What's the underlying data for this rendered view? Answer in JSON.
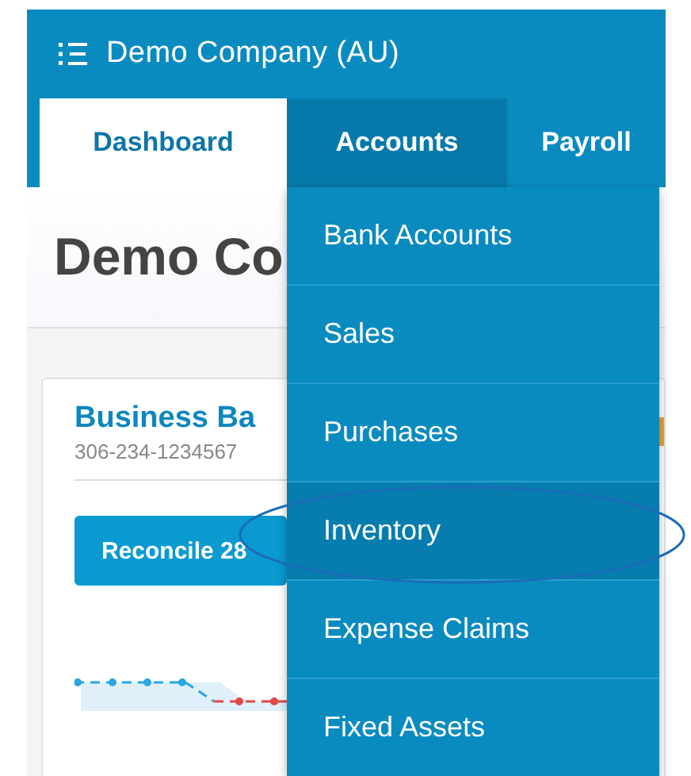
{
  "header": {
    "company": "Demo Company (AU)"
  },
  "tabs": [
    {
      "label": "Dashboard",
      "selected": true,
      "expanded": false
    },
    {
      "label": "Accounts",
      "selected": false,
      "expanded": true
    },
    {
      "label": "Payroll",
      "selected": false,
      "expanded": false
    }
  ],
  "page_title": "Demo Co",
  "card": {
    "title": "Business Ba",
    "account_number": "306-234-1234567",
    "button": "Reconcile 28"
  },
  "menu": {
    "items": [
      {
        "label": "Bank Accounts",
        "selected": false
      },
      {
        "label": "Sales",
        "selected": false
      },
      {
        "label": "Purchases",
        "selected": false
      },
      {
        "label": "Inventory",
        "selected": true
      },
      {
        "label": "Expense Claims",
        "selected": false
      },
      {
        "label": "Fixed Assets",
        "selected": false
      }
    ]
  },
  "annotation": {
    "kind": "ellipse"
  }
}
